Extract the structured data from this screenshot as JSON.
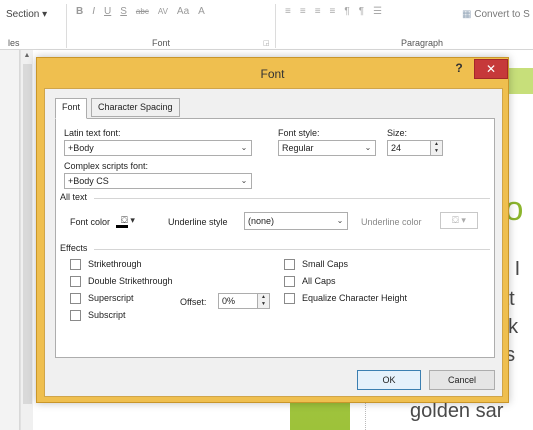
{
  "ribbon": {
    "section_label": "Section",
    "font_buttons": [
      "B",
      "I",
      "U",
      "S",
      "abc",
      "AV",
      "Aa",
      "A"
    ],
    "convert_label": "Convert to S",
    "group_left": "les",
    "group_font": "Font",
    "group_paragraph": "Paragraph"
  },
  "slide": {
    "fragments": [
      "io",
      "e I",
      "at",
      "nk",
      "es",
      "a",
      "golden sar"
    ]
  },
  "dialog": {
    "title": "Font",
    "help": "?",
    "close": "✕",
    "tabs": [
      "Font",
      "Character Spacing"
    ],
    "latin_font_label": "Latin text font:",
    "latin_font_value": "+Body",
    "font_style_label": "Font style:",
    "font_style_value": "Regular",
    "size_label": "Size:",
    "size_value": "24",
    "complex_font_label": "Complex scripts font:",
    "complex_font_value": "+Body CS",
    "all_text_label": "All text",
    "font_color_label": "Font color",
    "underline_style_label": "Underline style",
    "underline_style_value": "(none)",
    "underline_color_label": "Underline color",
    "effects_label": "Effects",
    "effects_left": [
      "Strikethrough",
      "Double Strikethrough",
      "Superscript",
      "Subscript"
    ],
    "offset_label": "Offset:",
    "offset_value": "0%",
    "effects_right": [
      "Small Caps",
      "All Caps",
      "Equalize Character Height"
    ],
    "ok_label": "OK",
    "cancel_label": "Cancel"
  },
  "colors": {
    "dialog_frame": "#efbf4f",
    "close_button": "#c6393a",
    "slide_green": "#9dc23a"
  }
}
